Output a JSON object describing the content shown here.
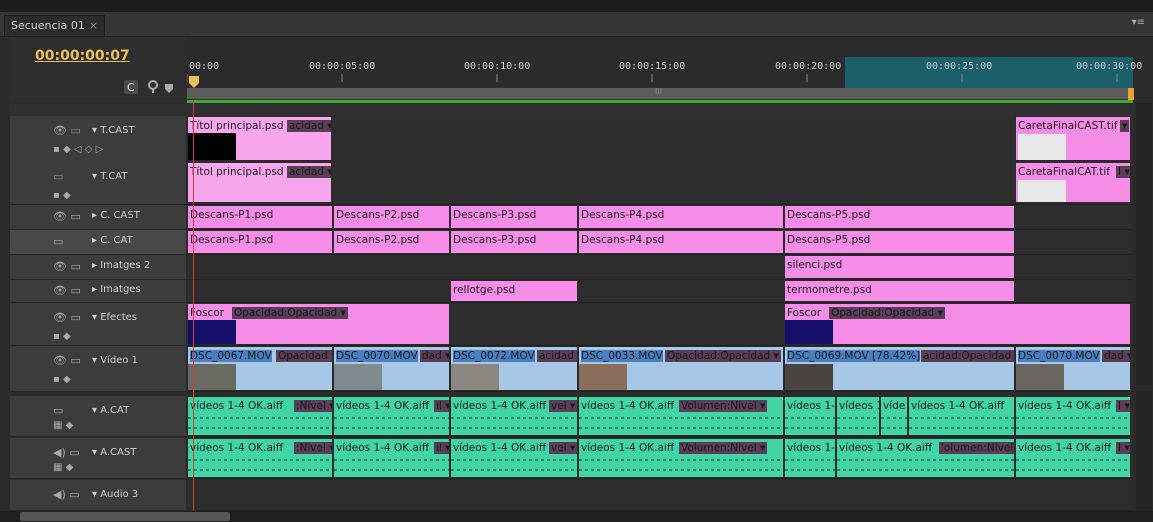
{
  "panel": {
    "tab_label": "Secuencia 01",
    "tab_close": "×",
    "menu_icon": "▾≡"
  },
  "timecode": "00:00:00:07",
  "ruler": {
    "ticks": [
      "00:00",
      "00:00:05:00",
      "00:00:10:00",
      "00:00:15:00",
      "00:00:20:00",
      "00:00:25:00",
      "00:00:30:00"
    ],
    "work_grip": "III"
  },
  "tracks": {
    "tcast": {
      "name": "T.CAST"
    },
    "tcat": {
      "name": "T.CAT"
    },
    "ccast": {
      "name": "C. CAST"
    },
    "ccat": {
      "name": "C. CAT"
    },
    "imatges2": {
      "name": "Imatges 2"
    },
    "imatges": {
      "name": "Imatges"
    },
    "efectes": {
      "name": "Efectes"
    },
    "video1": {
      "name": "Vídeo 1"
    },
    "acat": {
      "name": "A.CAT"
    },
    "acast": {
      "name": "A.CAST"
    },
    "audio3": {
      "name": "Audio 3"
    }
  },
  "clips": {
    "tcast_1": "Títol principal.psd",
    "tcast_1_fx": "acidad ▾",
    "tcast_2": "CaretaFinalCAST.tif",
    "tcast_2_fx": "▾",
    "tcat_1": "Títol principal.psd",
    "tcat_1_fx": "acidad ▾",
    "tcat_2": "CaretaFinalCAT.tif",
    "tcat_2_fx": "I ▾",
    "ccast": [
      "Descans-P1.psd",
      "Descans-P2.psd",
      "Descans-P3.psd",
      "Descans-P4.psd",
      "Descans-P5.psd"
    ],
    "ccat": [
      "Descans-P1.psd",
      "Descans-P2.psd",
      "Descans-P3.psd",
      "Descans-P4.psd",
      "Descans-P5.psd"
    ],
    "imatges2_1": "silenci.psd",
    "imatges_1": "rellotge.psd",
    "imatges_2": "termometre.psd",
    "efectes_1": "Foscor",
    "efectes_1_fx": "Opacidad:Opacidad ▾",
    "efectes_2": "Foscor",
    "efectes_2_fx": "Opacidad:Opacidad ▾",
    "v1": [
      "DSC_0067.MOV",
      "DSC_0070.MOV",
      "DSC_0072.MOV",
      "DSC_0033.MOV",
      "DSC_0069.MOV [78.42%]",
      "DSC_0070.MOV"
    ],
    "v1_fx": [
      "Opacidad ▾",
      "dad ▾",
      "acidad ▾",
      "Opacidad:Opacidad ▾",
      "acidad:Opacidad ▾",
      "dad ▾"
    ],
    "acat": [
      "vídeos 1-4 OK.aiff",
      "vídeos 1-4 OK.aiff",
      "vídeos 1-4 OK.aiff",
      "vídeos 1-4 OK.aiff",
      "vídeos 1-",
      "vídeos 1",
      "víde",
      "vídeos 1-4 OK.aiff",
      "vídeos 1-4 OK.aiff"
    ],
    "acat_fx": [
      ":Nivel ▾",
      "il ▾",
      "vel ▾",
      "Volumen:Nivel ▾",
      "",
      "",
      "",
      "",
      "I ▾"
    ],
    "acast": [
      "vídeos 1-4 OK.aiff",
      "vídeos 1-4 OK.aiff",
      "vídeos 1-4 OK.aiff",
      "vídeos 1-4 OK.aiff",
      "vídeos 1-",
      "vídeos 1-4 OK.aiff",
      "vídeos 1-4 OK.aiff"
    ],
    "acast_fx": [
      ":Nivel ▾",
      "il ▾",
      "vel ▾",
      "Volumen:Nivel ▾",
      "",
      "'olumen:Nivel ▾",
      "I ▾"
    ]
  },
  "colors": {
    "timecode": "#e8c15a",
    "playhead": "#d23c3c",
    "still_clip": "#f48ce8",
    "video_clip": "#a6c7e6",
    "audio_clip": "#41d4a4",
    "render_bar": "#3faa2e"
  }
}
